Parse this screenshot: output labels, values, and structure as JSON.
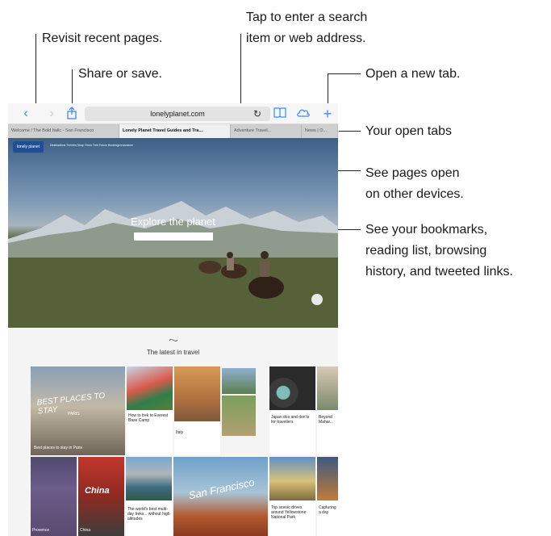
{
  "callouts": {
    "recent_pages": "Revisit recent pages.",
    "share_save": "Share or save.",
    "search_line1": "Tap to enter a search",
    "search_line2": "item or web address.",
    "new_tab": "Open a new tab.",
    "open_tabs": "Your open tabs",
    "other_devices_line1": "See pages open",
    "other_devices_line2": "on other devices.",
    "bookmarks_line1": "See your bookmarks,",
    "bookmarks_line2": "reading list, browsing",
    "bookmarks_line3": "history, and tweeted links."
  },
  "browser": {
    "address": "lonelyplanet.com",
    "icons": {
      "back": "back-icon",
      "forward": "forward-icon",
      "share": "share-icon",
      "reload": "reload-icon",
      "bookmarks": "bookmarks-icon",
      "icloud": "icloud-tabs-icon",
      "add": "add-tab-icon"
    },
    "tabs": [
      "Welcome / The Bold Italic - San Francisco",
      "Lonely Planet Travel Guides and Tra...",
      "Adventure Travel...",
      "News | O..."
    ]
  },
  "site": {
    "logo": "lonely planet",
    "nav": "Destinations   Themes   Shop   Thorn Tree Forum   Bookings   Insurance",
    "hero_title": "Explore the planet",
    "latest_title": "The latest in travel",
    "cards": {
      "best_places": "BEST PLACES TO STAY",
      "best_places_sub": "PARIS",
      "best_places_caption": "Best places to stay in Paris",
      "everest": "How to trek to Everest Base Camp",
      "italy": "Italy",
      "japan": "Japan dos and don'ts for travellers",
      "beyond": "Beyond Mahar...",
      "provence": "Provence",
      "china": "China",
      "china_caption": "China",
      "day_treks": "The world's best multi-day treks... without high altitudes",
      "san_francisco": "San Francisco",
      "yellowstone": "Top scenic drives around Yellowstone National Park",
      "capture": "Capturing a day"
    }
  }
}
